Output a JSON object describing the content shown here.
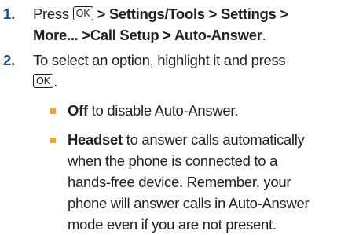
{
  "steps": [
    {
      "number": "1.",
      "text_press": "Press",
      "key_label": "OK",
      "path_line1": "> Settings/Tools > Settings >",
      "path_line2": "More... >Call Setup > Auto-Answer",
      "period": "."
    },
    {
      "number": "2.",
      "text_line1": "To select an option, highlight it and press",
      "key_label": "OK",
      "period": "."
    }
  ],
  "options": [
    {
      "name": "Off",
      "description": " to disable Auto-Answer."
    },
    {
      "name": "Headset",
      "description_line1": " to answer calls automatically",
      "description_line2": "when the phone is connected to a",
      "description_line3": "hands-free device. Remember, your",
      "description_line4": "phone will answer calls in Auto-Answer",
      "description_line5": "mode even if you are not present."
    }
  ],
  "colors": {
    "step_number": "#1a4f8a",
    "bullet": "#f2a61e",
    "text": "#231f20"
  }
}
